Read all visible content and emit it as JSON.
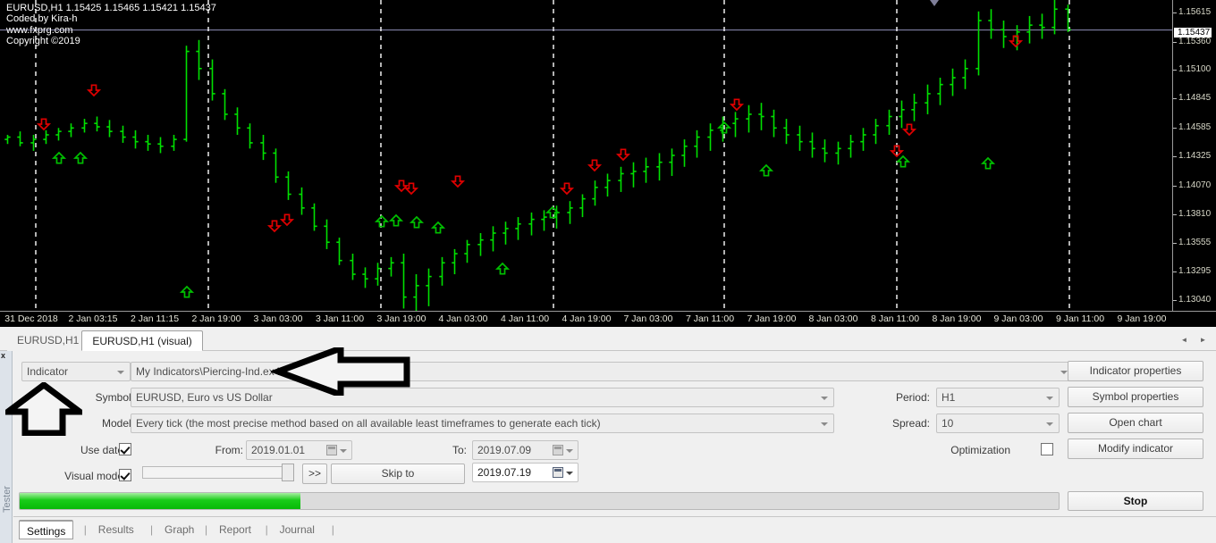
{
  "chart": {
    "header_lines": [
      "EURUSD,H1  1.15425 1.15465 1.15421 1.15437",
      "Coded by Kira-h",
      "www.fxprg.com",
      "Copyright ©2019"
    ],
    "symbol_line": "EURUSD,H1  1.15425 1.15465 1.15421 1.15437",
    "author_line": "Coded by Kira-h",
    "site_line": "www.fxprg.com",
    "copyright_line": "Copyright ©2019",
    "current_price": "1.15437",
    "price_ticks": [
      "1.15615",
      "1.15360",
      "1.15100",
      "1.14845",
      "1.14585",
      "1.14325",
      "1.14070",
      "1.13810",
      "1.13555",
      "1.13295",
      "1.13040"
    ],
    "time_ticks": [
      "31 Dec 2018",
      "2 Jan 03:15",
      "2 Jan 11:15",
      "2 Jan 19:00",
      "3 Jan 03:00",
      "3 Jan 11:00",
      "3 Jan 19:00",
      "4 Jan 03:00",
      "4 Jan 11:00",
      "4 Jan 19:00",
      "7 Jan 03:00",
      "7 Jan 11:00",
      "7 Jan 19:00",
      "8 Jan 03:00",
      "8 Jan 11:00",
      "8 Jan 19:00",
      "9 Jan 03:00",
      "9 Jan 11:00",
      "9 Jan 19:00"
    ],
    "colors": {
      "background": "#000000",
      "bar_up": "#00e000",
      "signal_sell": "#e00000",
      "signal_buy": "#00c000",
      "grid": "#ffffff",
      "price_text": "#d8d8c8"
    }
  },
  "chart_tabs": {
    "items": [
      {
        "label": "EURUSD,H1",
        "active": false
      },
      {
        "label": "EURUSD,H1 (visual)",
        "active": true
      }
    ],
    "scroll_left": "◄",
    "scroll_right": "►"
  },
  "tester": {
    "vertical_label": "Tester",
    "close_label": "x",
    "mode_select": "Indicator",
    "file_path": "My Indicators\\Piercing-Ind.ex4",
    "symbol_label": "Symbol:",
    "symbol_value": "EURUSD, Euro vs US Dollar",
    "model_label": "Model:",
    "model_value": "Every tick (the most precise method based on all available least timeframes to generate each tick)",
    "period_label": "Period:",
    "period_value": "H1",
    "spread_label": "Spread:",
    "spread_value": "10",
    "use_date_label": "Use date",
    "use_date_checked": true,
    "from_label": "From:",
    "from_value": "2019.01.01",
    "to_label": "To:",
    "to_value": "2019.07.09",
    "visual_mode_label": "Visual mode",
    "visual_mode_checked": true,
    "fast_forward_label": ">>",
    "skip_to_label": "Skip to",
    "skip_to_date": "2019.07.19",
    "optimization_label": "Optimization",
    "optimization_checked": false,
    "progress_percent": 27,
    "buttons": {
      "indicator_properties": "Indicator properties",
      "symbol_properties": "Symbol properties",
      "open_chart": "Open chart",
      "modify_indicator": "Modify indicator",
      "stop": "Stop"
    }
  },
  "bottom_tabs": {
    "items": [
      {
        "label": "Settings",
        "active": true
      },
      {
        "label": "Results",
        "active": false
      },
      {
        "label": "Graph",
        "active": false
      },
      {
        "label": "Report",
        "active": false
      },
      {
        "label": "Journal",
        "active": false
      }
    ],
    "separator": "|"
  },
  "annotations": {
    "arrow_left_target": "file-path-field",
    "arrow_up_target": "mode-select"
  },
  "chart_data": {
    "type": "ohlc",
    "title": "EURUSD,H1",
    "ylim": [
      1.1298,
      1.157
    ],
    "xlabel": "",
    "ylabel": "",
    "grid": true,
    "bars": [
      [
        1.1448,
        1.1452,
        1.1444,
        1.145
      ],
      [
        1.145,
        1.1455,
        1.1442,
        1.1445
      ],
      [
        1.1445,
        1.1452,
        1.1438,
        1.1448
      ],
      [
        1.1448,
        1.1456,
        1.1444,
        1.1452
      ],
      [
        1.1452,
        1.1458,
        1.1447,
        1.1455
      ],
      [
        1.1455,
        1.1462,
        1.145,
        1.1458
      ],
      [
        1.1458,
        1.1466,
        1.1454,
        1.1462
      ],
      [
        1.1462,
        1.1468,
        1.1455,
        1.1459
      ],
      [
        1.1459,
        1.1465,
        1.145,
        1.1455
      ],
      [
        1.1455,
        1.146,
        1.1445,
        1.145
      ],
      [
        1.145,
        1.1456,
        1.144,
        1.1446
      ],
      [
        1.1446,
        1.1452,
        1.1438,
        1.1444
      ],
      [
        1.1444,
        1.145,
        1.1436,
        1.1442
      ],
      [
        1.1442,
        1.1452,
        1.1438,
        1.1448
      ],
      [
        1.1448,
        1.153,
        1.1446,
        1.1525
      ],
      [
        1.1525,
        1.1535,
        1.15,
        1.151
      ],
      [
        1.151,
        1.1518,
        1.1482,
        1.1488
      ],
      [
        1.1488,
        1.1492,
        1.1465,
        1.147
      ],
      [
        1.147,
        1.1476,
        1.1452,
        1.1458
      ],
      [
        1.1458,
        1.1462,
        1.144,
        1.1445
      ],
      [
        1.1445,
        1.1452,
        1.143,
        1.1436
      ],
      [
        1.1436,
        1.144,
        1.141,
        1.1415
      ],
      [
        1.1415,
        1.142,
        1.1395,
        1.14
      ],
      [
        1.14,
        1.1406,
        1.1382,
        1.1388
      ],
      [
        1.1388,
        1.1392,
        1.1368,
        1.1372
      ],
      [
        1.1372,
        1.1378,
        1.1352,
        1.1358
      ],
      [
        1.1358,
        1.1362,
        1.1338,
        1.1342
      ],
      [
        1.1342,
        1.1348,
        1.1325,
        1.133
      ],
      [
        1.133,
        1.1336,
        1.1318,
        1.1326
      ],
      [
        1.1326,
        1.134,
        1.132,
        1.1335
      ],
      [
        1.1335,
        1.1345,
        1.1328,
        1.134
      ],
      [
        1.134,
        1.1348,
        1.13,
        1.131
      ],
      [
        1.131,
        1.133,
        1.1296,
        1.132
      ],
      [
        1.132,
        1.1335,
        1.1302,
        1.1328
      ],
      [
        1.1328,
        1.1345,
        1.132,
        1.134
      ],
      [
        1.134,
        1.1352,
        1.133,
        1.1348
      ],
      [
        1.1348,
        1.136,
        1.134,
        1.1356
      ],
      [
        1.1356,
        1.1366,
        1.1346,
        1.136
      ],
      [
        1.136,
        1.1372,
        1.135,
        1.1366
      ],
      [
        1.1366,
        1.1376,
        1.1356,
        1.137
      ],
      [
        1.137,
        1.138,
        1.136,
        1.1374
      ],
      [
        1.1374,
        1.1384,
        1.1364,
        1.1378
      ],
      [
        1.1378,
        1.1386,
        1.1368,
        1.138
      ],
      [
        1.138,
        1.139,
        1.137,
        1.1384
      ],
      [
        1.1384,
        1.1394,
        1.1374,
        1.1388
      ],
      [
        1.1388,
        1.14,
        1.138,
        1.1396
      ],
      [
        1.1396,
        1.1412,
        1.139,
        1.1406
      ],
      [
        1.1406,
        1.1418,
        1.1398,
        1.1412
      ],
      [
        1.1412,
        1.1424,
        1.1402,
        1.1418
      ],
      [
        1.1418,
        1.1428,
        1.1406,
        1.142
      ],
      [
        1.142,
        1.1432,
        1.141,
        1.1424
      ],
      [
        1.1424,
        1.1436,
        1.1412,
        1.1428
      ],
      [
        1.1428,
        1.144,
        1.1416,
        1.1434
      ],
      [
        1.1434,
        1.1448,
        1.1424,
        1.1442
      ],
      [
        1.1442,
        1.1456,
        1.1432,
        1.145
      ],
      [
        1.145,
        1.1462,
        1.1438,
        1.1456
      ],
      [
        1.1456,
        1.1468,
        1.1446,
        1.1462
      ],
      [
        1.1462,
        1.1472,
        1.145,
        1.1466
      ],
      [
        1.1466,
        1.1478,
        1.1454,
        1.147
      ],
      [
        1.147,
        1.148,
        1.1456,
        1.1468
      ],
      [
        1.1468,
        1.1474,
        1.145,
        1.1458
      ],
      [
        1.1458,
        1.1466,
        1.1444,
        1.1452
      ],
      [
        1.1452,
        1.146,
        1.1438,
        1.1446
      ],
      [
        1.1446,
        1.1454,
        1.1432,
        1.144
      ],
      [
        1.144,
        1.1448,
        1.1428,
        1.1436
      ],
      [
        1.1436,
        1.1446,
        1.1426,
        1.144
      ],
      [
        1.144,
        1.1452,
        1.1432,
        1.1446
      ],
      [
        1.1446,
        1.1458,
        1.1438,
        1.1452
      ],
      [
        1.1452,
        1.1466,
        1.1444,
        1.146
      ],
      [
        1.146,
        1.1474,
        1.1452,
        1.1468
      ],
      [
        1.1468,
        1.1482,
        1.1458,
        1.1474
      ],
      [
        1.1474,
        1.1488,
        1.1464,
        1.148
      ],
      [
        1.148,
        1.1496,
        1.147,
        1.1488
      ],
      [
        1.1488,
        1.1502,
        1.1478,
        1.1496
      ],
      [
        1.1496,
        1.151,
        1.1486,
        1.1502
      ],
      [
        1.1502,
        1.1518,
        1.1492,
        1.151
      ],
      [
        1.151,
        1.156,
        1.1504,
        1.1552
      ],
      [
        1.1552,
        1.1562,
        1.1536,
        1.1544
      ],
      [
        1.1544,
        1.1552,
        1.1528,
        1.1538
      ],
      [
        1.1538,
        1.1548,
        1.1526,
        1.1542
      ],
      [
        1.1542,
        1.1556,
        1.1532,
        1.1548
      ],
      [
        1.1548,
        1.1558,
        1.1536,
        1.1546
      ],
      [
        1.1546,
        1.157,
        1.154,
        1.1562
      ],
      [
        1.1562,
        1.1566,
        1.1542,
        1.1544
      ]
    ],
    "buy_signals": 12,
    "sell_signals": 13
  }
}
